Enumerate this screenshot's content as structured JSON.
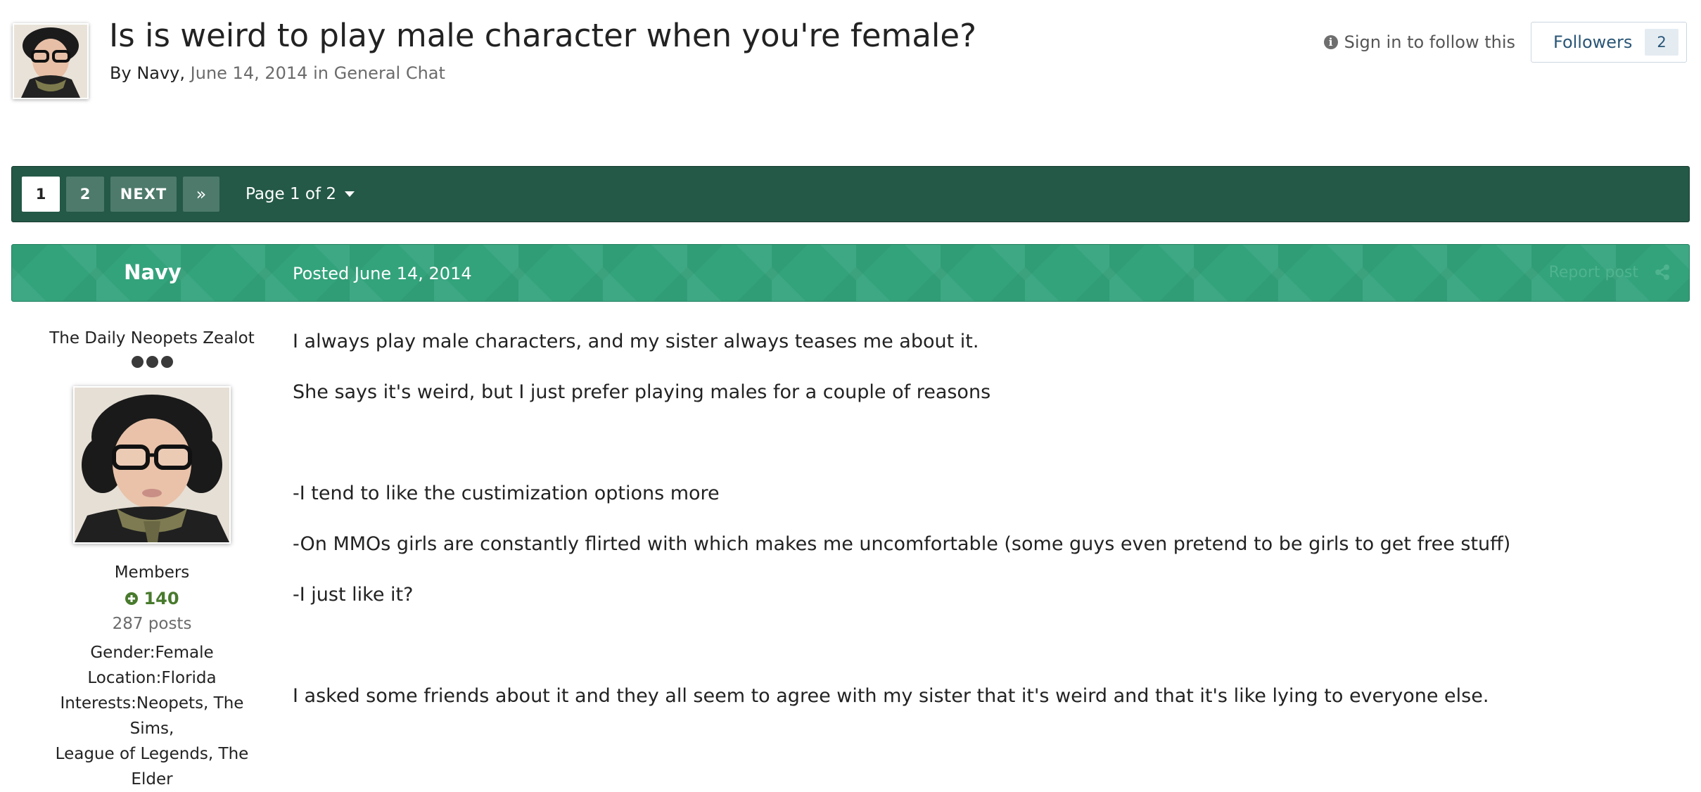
{
  "topic": {
    "title": "Is is weird to play male character when you're female?",
    "by_label": "By",
    "author": "Navy,",
    "date": "June 14, 2014",
    "in_label": "in",
    "forum": "General Chat",
    "sign_in_follow": "Sign in to follow this",
    "followers_label": "Followers",
    "followers_count": "2"
  },
  "pagination": {
    "pages": [
      "1",
      "2"
    ],
    "active_page": "1",
    "next_label": "NEXT",
    "last_label": "»",
    "page_jump_label": "Page 1 of 2"
  },
  "post": {
    "author": "Navy",
    "posted_label": "Posted June 14, 2014",
    "report_label": "Report post",
    "paragraphs": [
      "I always play male characters, and my sister always teases me about it.",
      "She says it's weird, but I just prefer playing males for a couple of reasons",
      "-I tend to like the custimization options more",
      "-On MMOs girls are constantly flirted with which makes me uncomfortable (some guys even pretend to be girls to get free stuff)",
      "-I just like it?",
      "I asked some friends about it and they all seem to agree with my sister that it's weird and that it's like lying to everyone else."
    ]
  },
  "author_info": {
    "rank_title": "The Daily Neopets Zealot",
    "rank_pips": 3,
    "group": "Members",
    "reputation": "140",
    "post_count": "287 posts",
    "gender": "Gender:Female",
    "location": "Location:Florida",
    "interests_line1": "Interests:Neopets, The Sims,",
    "interests_line2": "League of Legends, The Elder"
  },
  "colors": {
    "pagination_bg": "#245847",
    "post_header_bg": "#33a37c",
    "reputation": "#487a2d",
    "link": "#2a5677"
  }
}
